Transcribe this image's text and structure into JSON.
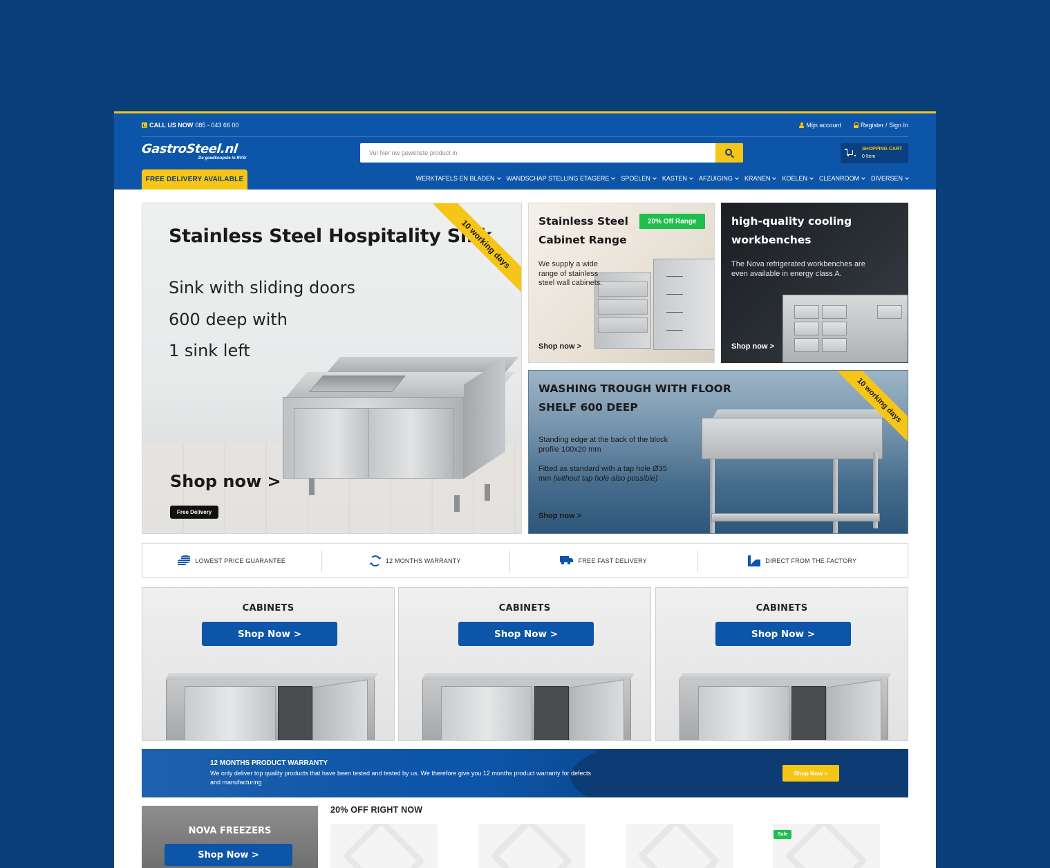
{
  "topbar": {
    "call_label": "CALL US NOW",
    "phone": "085 - 043 66 00",
    "account_label": "Mijn account",
    "register_label": "Register / Sign In"
  },
  "logo": {
    "wordmark": "GastroSteel.nl",
    "tagline": "De goedkoopste in RVS!"
  },
  "search": {
    "placeholder": "Vul hier uw gewenste product in"
  },
  "cart": {
    "title": "SHOPPING CART",
    "items": "0 Item"
  },
  "delivery_tab": "FREE DELIVERY AVAILABLE",
  "nav": {
    "items": [
      "WERKTAFELS EN BLADEN",
      "WANDSCHAP STELLING ETAGERE",
      "SPOELEN",
      "KASTEN",
      "AFZUIGING",
      "KRANEN",
      "KOELEN",
      "CLEANROOM",
      "DIVERSEN"
    ]
  },
  "hero": {
    "title": "Stainless Steel Hospitality Sink",
    "line1": "Sink with sliding doors",
    "line2": "600 deep with",
    "line3": "1 sink left",
    "shop": "Shop now >",
    "badge": "Free Delivery",
    "ribbon": "10 working days"
  },
  "cabinet_banner": {
    "title1": "Stainless Steel",
    "title2": "Cabinet Range",
    "badge": "20% Off Range",
    "desc": "We supply a wide range of stainless steel wall cabinets.",
    "shop": "Shop now >"
  },
  "cooling_banner": {
    "title1": "high-quality cooling",
    "title2": "workbenches",
    "desc": "The Nova refrigerated workbenches are even available in energy class A.",
    "shop": "Shop now >"
  },
  "trough_banner": {
    "title1": "WASHING TROUGH WITH FLOOR",
    "title2": "SHELF 600 DEEP",
    "desc1": "Standing edge at the back of the block profile 100x20 mm",
    "desc2_a": "Fitted as standard with a tap hole Ø35 mm ",
    "desc2_b": "(without tap hole also possible)",
    "shop": "Shop now >",
    "ribbon": "10 working days"
  },
  "usp": [
    {
      "icon": "coins-icon",
      "label": "LOWEST PRICE GUARANTEE"
    },
    {
      "icon": "refresh-icon",
      "label": "12 MONTHS WARRANTY"
    },
    {
      "icon": "truck-icon",
      "label": "FREE FAST DELIVERY"
    },
    {
      "icon": "factory-icon",
      "label": "DIRECT FROM THE FACTORY"
    }
  ],
  "tiles": [
    {
      "title": "CABINETS",
      "button": "Shop Now >"
    },
    {
      "title": "CABINETS",
      "button": "Shop Now >"
    },
    {
      "title": "CABINETS",
      "button": "Shop Now >"
    }
  ],
  "warranty": {
    "title": "12 MONTHS PRODUCT WARRANTY",
    "desc": "We only deliver top quality products that have been tested and tested by us. We therefore give you 12 months product warranty for defects and manufacturing",
    "button": "Shop Now >"
  },
  "nova": {
    "title": "NOVA FREEZERS",
    "button": "Shop Now >"
  },
  "offers": {
    "heading": "20% OFF RIGHT NOW",
    "sale_badge": "Sale"
  },
  "colors": {
    "page_bg": "#0b3f7a",
    "header_blue": "#0d55a8",
    "accent_yellow": "#f5c518",
    "sale_green": "#1fbf4b"
  }
}
